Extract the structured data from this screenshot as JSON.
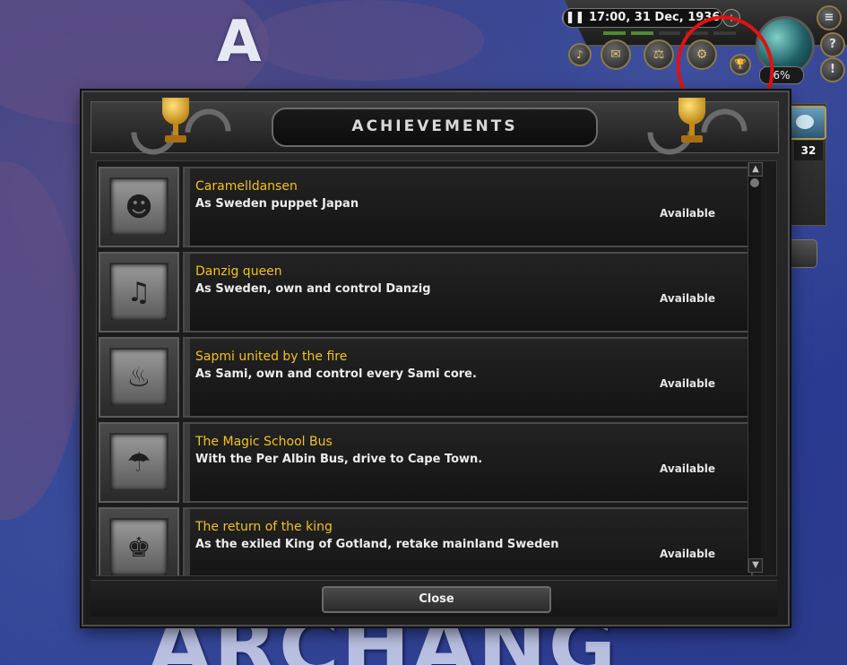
{
  "hud": {
    "pause_icon": "pause-icon",
    "datetime": "17:00, 31 Dec, 1936",
    "progress_label": "6%",
    "speed_level": 2,
    "speed_max": 5
  },
  "side_panel": {
    "count_badge": "32"
  },
  "map": {
    "region_letter": "A",
    "country_name": "ARCHANG"
  },
  "window": {
    "title": "ACHIEVEMENTS",
    "close_label": "Close",
    "achievements": [
      {
        "name": "Caramelldansen",
        "description": "As Sweden puppet Japan",
        "status": "Available",
        "icon": "dancers-icon"
      },
      {
        "name": "Danzig queen",
        "description": "As Sweden, own and control Danzig",
        "status": "Available",
        "icon": "band-icon"
      },
      {
        "name": "Sapmi united by the fire",
        "description": "As Sami, own and control every Sami core.",
        "status": "Available",
        "icon": "fire-icon"
      },
      {
        "name": "The Magic School Bus",
        "description": "With the Per Albin Bus, drive to Cape Town.",
        "status": "Available",
        "icon": "parachute-bus-icon"
      },
      {
        "name": "The return of the king",
        "description": "As the exiled King of Gotland, retake mainland Sweden",
        "status": "Available",
        "icon": "king-icon"
      }
    ]
  },
  "colors": {
    "achievement_name": "#f2c21b",
    "annotation_circle": "#e01212"
  }
}
